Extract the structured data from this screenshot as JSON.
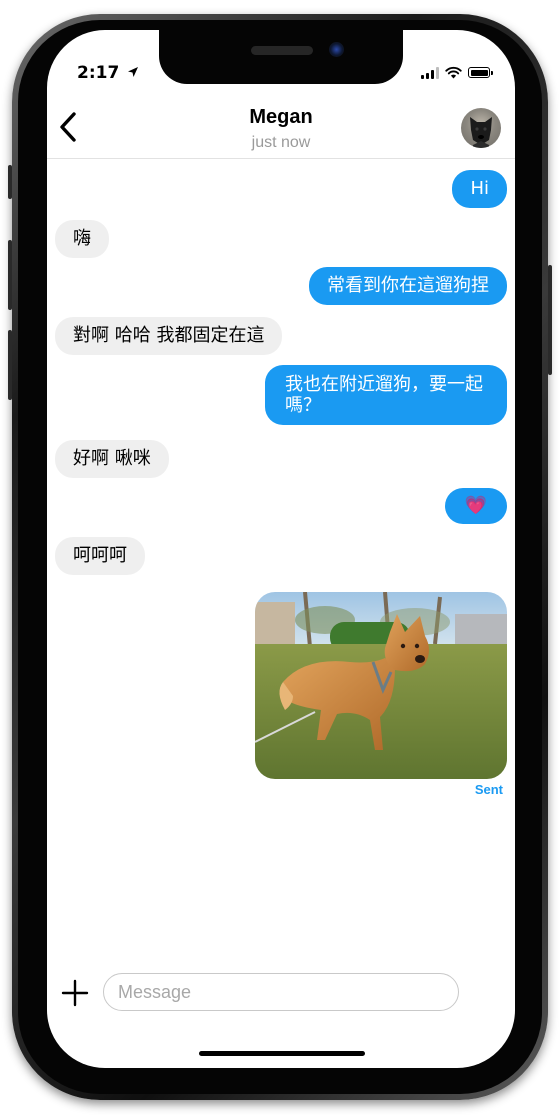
{
  "status_bar": {
    "time": "2:17",
    "icons": [
      "location-arrow-icon",
      "cellular-signal-icon",
      "wifi-icon",
      "battery-icon"
    ]
  },
  "header": {
    "back_icon": "chevron-left-icon",
    "contact_name": "Megan",
    "contact_status": "just now",
    "avatar": "dog-avatar"
  },
  "messages": [
    {
      "direction": "out",
      "text": "Hi"
    },
    {
      "direction": "in",
      "text": "嗨"
    },
    {
      "direction": "out",
      "text": "常看到你在這遛狗捏"
    },
    {
      "direction": "in",
      "text": "對啊 哈哈 我都固定在這"
    },
    {
      "direction": "out",
      "text": "我也在附近遛狗，要一起嗎？"
    },
    {
      "direction": "in",
      "text": "好啊 啾咪"
    },
    {
      "direction": "out",
      "text": "💗"
    },
    {
      "direction": "in",
      "text": "呵呵呵"
    },
    {
      "direction": "out",
      "type": "photo",
      "subject": "dog-photo"
    }
  ],
  "delivery_status": "Sent",
  "composer": {
    "add_icon": "plus-icon",
    "placeholder": "Message"
  },
  "colors": {
    "outgoing_bubble": "#1a9af2",
    "incoming_bubble": "#efefef",
    "sent_label": "#1a9af2"
  }
}
